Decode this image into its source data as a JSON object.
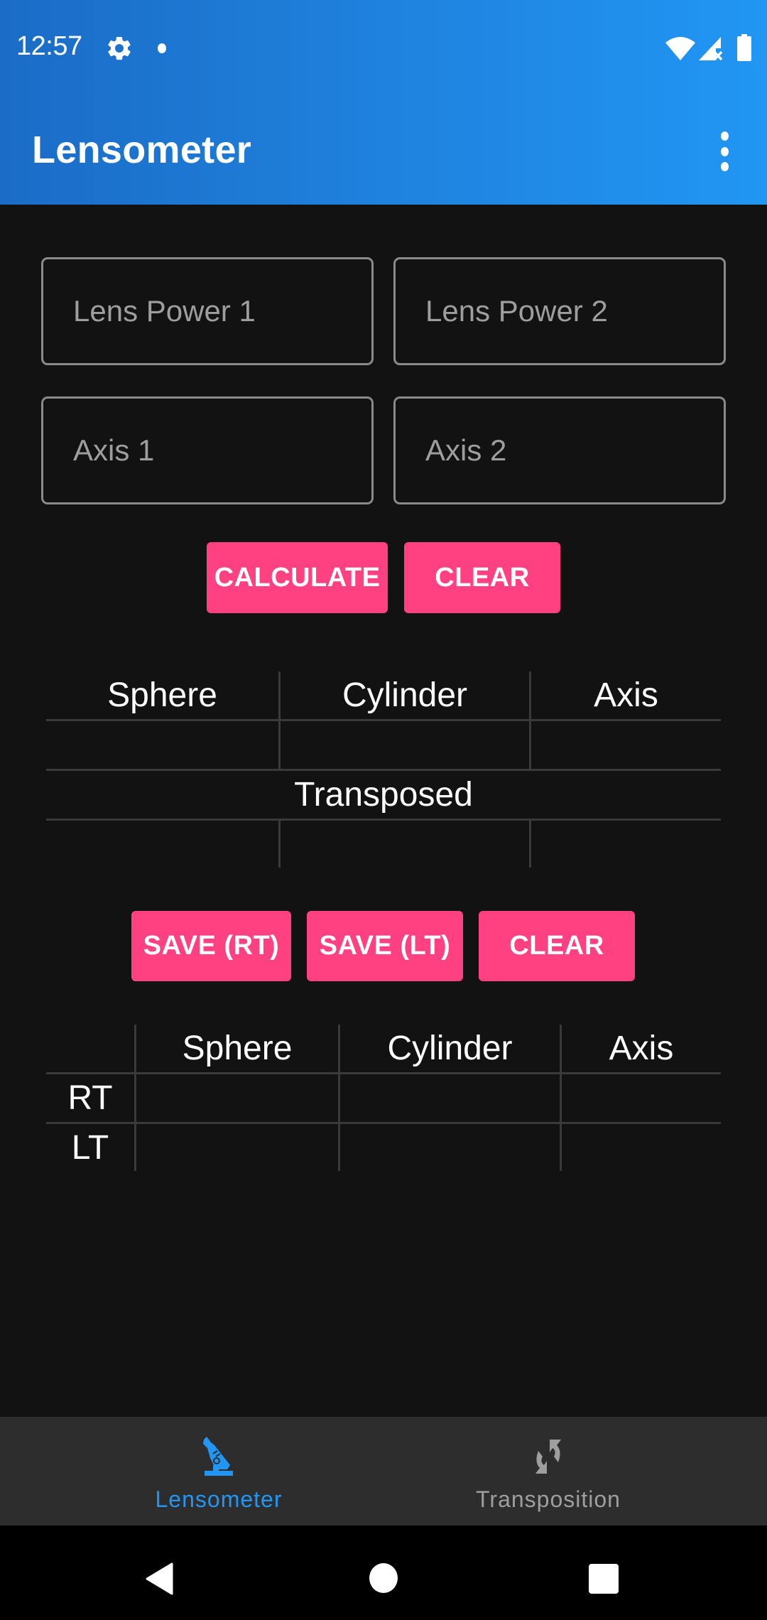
{
  "status_bar": {
    "time": "12:57",
    "icons": [
      "gear-icon",
      "notification-dot",
      "wifi-icon",
      "signal-no-sim-icon",
      "battery-icon"
    ]
  },
  "app_bar": {
    "title": "Lensometer",
    "overflow_icon": "more-vert-icon"
  },
  "inputs": {
    "lens_power_1": {
      "placeholder": "Lens Power 1",
      "value": ""
    },
    "lens_power_2": {
      "placeholder": "Lens Power 2",
      "value": ""
    },
    "axis_1": {
      "placeholder": "Axis 1",
      "value": ""
    },
    "axis_2": {
      "placeholder": "Axis 2",
      "value": ""
    }
  },
  "actions": {
    "calculate": "CALCULATE",
    "clear": "CLEAR"
  },
  "result_table": {
    "headers": [
      "Sphere",
      "Cylinder",
      "Axis"
    ],
    "result_row": [
      "",
      "",
      ""
    ],
    "transposed_label": "Transposed",
    "transposed_row": [
      "",
      "",
      ""
    ]
  },
  "save_actions": {
    "save_rt": "SAVE (RT)",
    "save_lt": "SAVE (LT)",
    "clear": "CLEAR"
  },
  "saved_table": {
    "corner": "",
    "headers": [
      "Sphere",
      "Cylinder",
      "Axis"
    ],
    "rows": [
      {
        "label": "RT",
        "values": [
          "",
          "",
          ""
        ]
      },
      {
        "label": "LT",
        "values": [
          "",
          "",
          ""
        ]
      }
    ]
  },
  "bottom_nav": {
    "items": [
      {
        "label": "Lensometer",
        "icon": "microscope-icon",
        "active": true
      },
      {
        "label": "Transposition",
        "icon": "sync-arrows-icon",
        "active": false
      }
    ]
  },
  "colors": {
    "primary": "#2196f3",
    "primary_dark": "#1b6cc6",
    "accent": "#ff4081",
    "background": "#121212",
    "bottom_nav_bg": "#2d2d2d",
    "inactive_nav": "#9e9e9e"
  }
}
